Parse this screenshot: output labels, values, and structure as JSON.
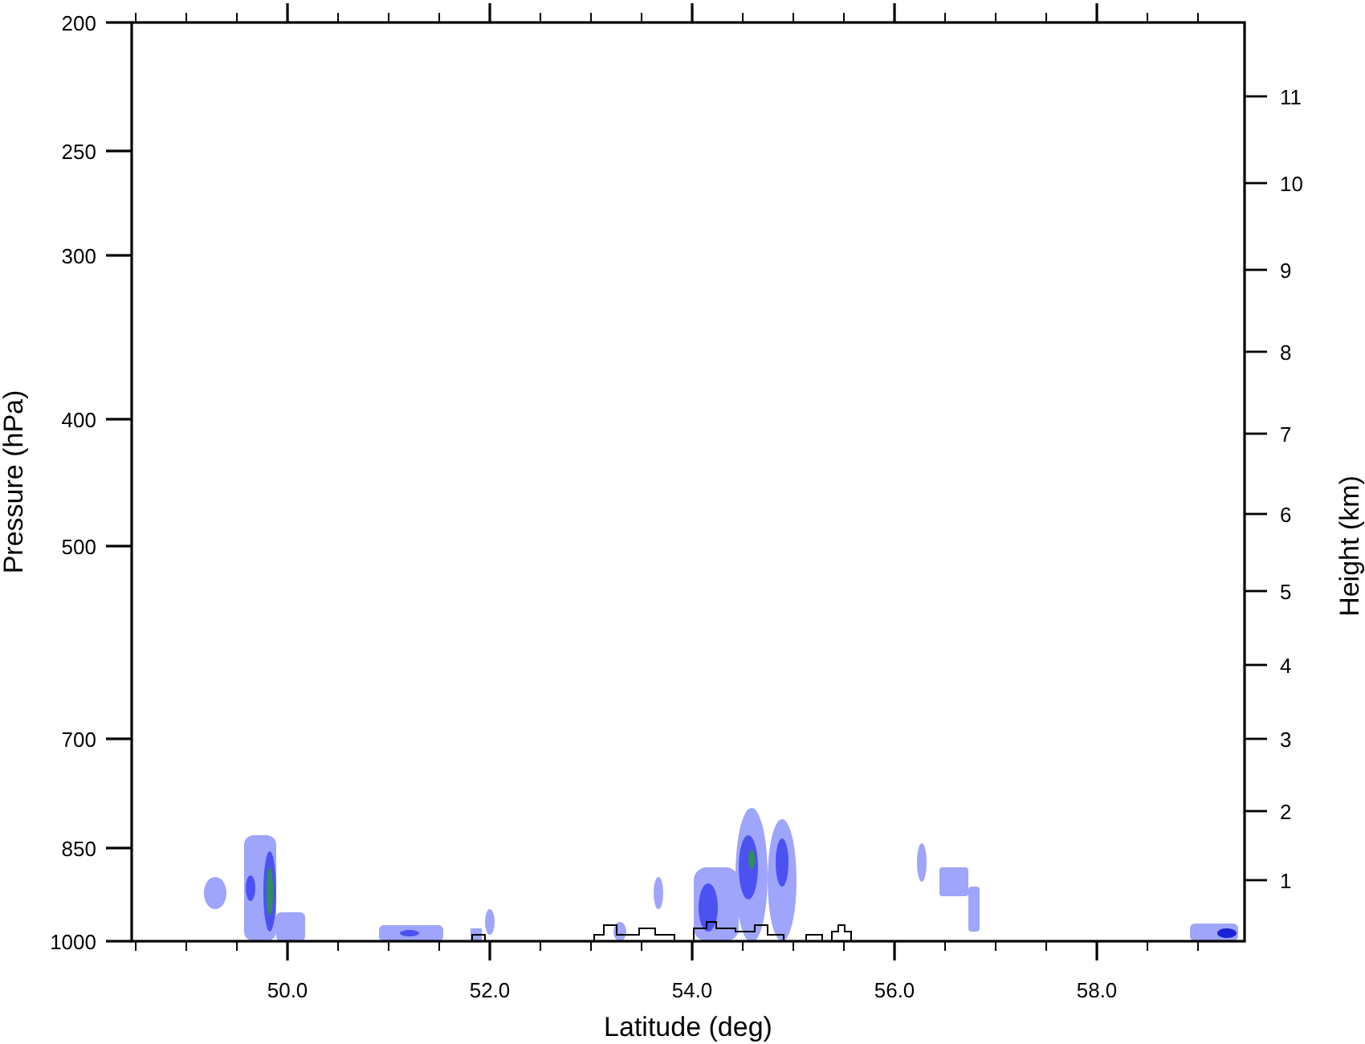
{
  "plot": {
    "left_axis": {
      "title": "Pressure (hPa)",
      "ticks": [
        "200",
        "250",
        "300",
        "400",
        "500",
        "700",
        "850",
        "1000"
      ]
    },
    "right_axis": {
      "title": "Height (km)",
      "ticks": [
        "11",
        "10",
        "9",
        "8",
        "7",
        "6",
        "5",
        "4",
        "3",
        "2",
        "1"
      ]
    },
    "x_axis": {
      "title": "Latitude (deg)",
      "ticks": [
        "50.0",
        "52.0",
        "54.0",
        "56.0",
        "58.0"
      ]
    }
  }
}
